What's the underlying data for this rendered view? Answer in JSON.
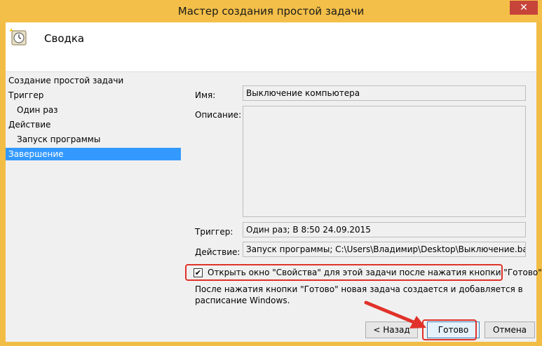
{
  "window": {
    "title": "Мастер создания простой задачи",
    "close_glyph": "✕"
  },
  "header": {
    "title": "Сводка"
  },
  "nav": {
    "items": [
      {
        "label": "Создание простой задачи"
      },
      {
        "label": "Триггер"
      },
      {
        "label": "Один раз"
      },
      {
        "label": "Действие"
      },
      {
        "label": "Запуск программы"
      },
      {
        "label": "Завершение"
      }
    ]
  },
  "form": {
    "name_label": "Имя:",
    "name_value": "Выключение компьютера",
    "description_label": "Описание:",
    "description_value": "",
    "trigger_label": "Триггер:",
    "trigger_value": "Один раз; В 8:50 24.09.2015",
    "action_label": "Действие:",
    "action_value": "Запуск программы; C:\\Users\\Владимир\\Desktop\\Выключение.bat"
  },
  "option": {
    "checked_glyph": "✔",
    "label": "Открыть окно \"Свойства\" для этой задачи после нажатия кнопки \"Готово\""
  },
  "note": "После нажатия кнопки \"Готово\" новая задача создается и добавляется в расписание Windows.",
  "buttons": {
    "back": "< Назад",
    "finish": "Готово",
    "cancel": "Отмена"
  },
  "colors": {
    "accent": "#3399ff",
    "highlight": "#e0322a",
    "titlebar": "#f3bf48"
  }
}
